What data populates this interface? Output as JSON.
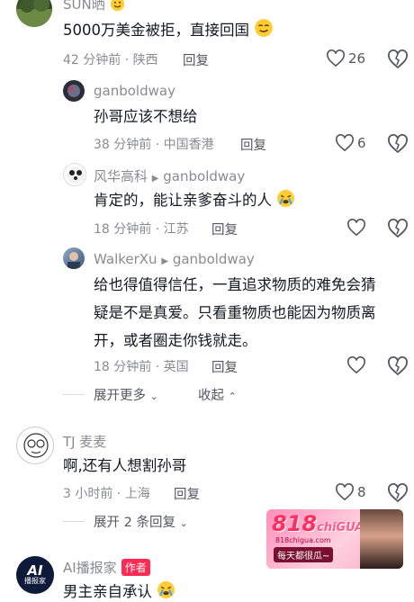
{
  "comments": [
    {
      "name": "SUN晒",
      "text": "5000万美金被拒，直接回国",
      "meta": "42 分钟前 · 陕西",
      "reply_label": "回复",
      "likes": "26"
    },
    {
      "name": "ganboldway",
      "text": "孙哥应该不想给",
      "meta": "38 分钟前 · 中国香港",
      "reply_label": "回复",
      "likes": "6"
    },
    {
      "name": "风华高科",
      "reply_to": "ganboldway",
      "text": "肯定的，能让亲爹奋斗的人",
      "meta": "18 分钟前 · 江苏",
      "reply_label": "回复"
    },
    {
      "name": "WalkerXu",
      "reply_to": "ganboldway",
      "text_lines": [
        "给也得值得信任，一直追求物质的难免会猜",
        "疑是不是真爱。只看重物质也能因为物质离",
        "开，或者圈走你钱就走。"
      ],
      "meta": "18 分钟前 · 英国",
      "reply_label": "回复"
    },
    {
      "name": "TJ 麦麦",
      "text": "啊,还有人想割孙哥",
      "meta": "3 小时前 · 上海",
      "reply_label": "回复",
      "likes": "8"
    },
    {
      "name": "AI播报家",
      "badge": "作者",
      "text": "男主亲自承认"
    }
  ],
  "thread": {
    "expand_more": "展开更多",
    "collapse": "收起",
    "expand_two": "展开 2 条回复"
  },
  "avatar_labels": {
    "ai": "AI",
    "ai_sub": "播报家"
  },
  "ad": {
    "brand": "818",
    "brand_sub": "chiGUA",
    "site": "818chigua.com",
    "slogan": "每天都很瓜~"
  },
  "colors": {
    "text": "#161823",
    "muted": "#8a8b91",
    "action": "#555660",
    "badge": "#fe2c55"
  }
}
